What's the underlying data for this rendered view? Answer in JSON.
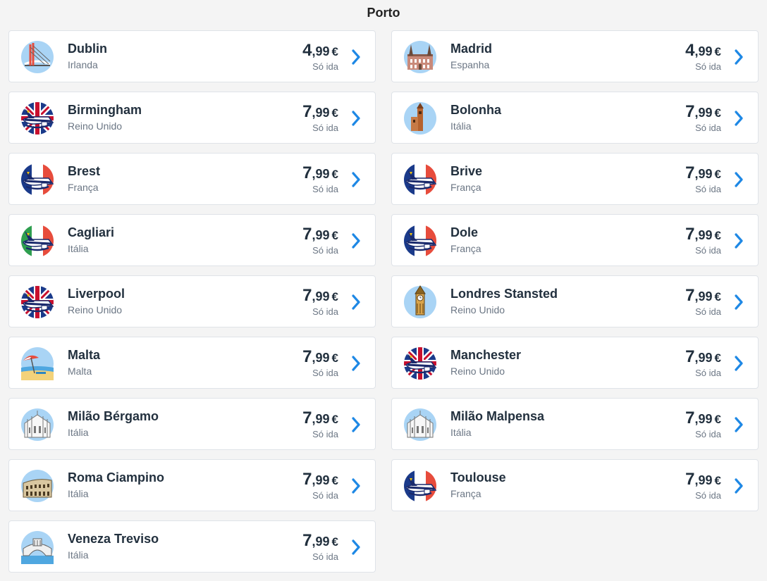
{
  "page": {
    "title": "Porto"
  },
  "colors": {
    "accent": "#1e88e5",
    "card_border": "#dfe3e8",
    "text": "#22303e",
    "muted": "#6b7684"
  },
  "destinations": [
    {
      "city": "Dublin",
      "country": "Irlanda",
      "price_int": "4",
      "price_dec": ",99",
      "currency": "€",
      "trip": "Só ida",
      "icon": "bridge-icon"
    },
    {
      "city": "Madrid",
      "country": "Espanha",
      "price_int": "4",
      "price_dec": ",99",
      "currency": "€",
      "trip": "Só ida",
      "icon": "palace-icon"
    },
    {
      "city": "Birmingham",
      "country": "Reino Unido",
      "price_int": "7",
      "price_dec": ",99",
      "currency": "€",
      "trip": "Só ida",
      "icon": "plane-uk-icon"
    },
    {
      "city": "Bolonha",
      "country": "Itália",
      "price_int": "7",
      "price_dec": ",99",
      "currency": "€",
      "trip": "Só ida",
      "icon": "tower-icon"
    },
    {
      "city": "Brest",
      "country": "França",
      "price_int": "7",
      "price_dec": ",99",
      "currency": "€",
      "trip": "Só ida",
      "icon": "plane-fr-icon"
    },
    {
      "city": "Brive",
      "country": "França",
      "price_int": "7",
      "price_dec": ",99",
      "currency": "€",
      "trip": "Só ida",
      "icon": "plane-fr-icon"
    },
    {
      "city": "Cagliari",
      "country": "Itália",
      "price_int": "7",
      "price_dec": ",99",
      "currency": "€",
      "trip": "Só ida",
      "icon": "plane-it-icon"
    },
    {
      "city": "Dole",
      "country": "França",
      "price_int": "7",
      "price_dec": ",99",
      "currency": "€",
      "trip": "Só ida",
      "icon": "plane-fr-icon"
    },
    {
      "city": "Liverpool",
      "country": "Reino Unido",
      "price_int": "7",
      "price_dec": ",99",
      "currency": "€",
      "trip": "Só ida",
      "icon": "plane-uk-icon"
    },
    {
      "city": "Londres Stansted",
      "country": "Reino Unido",
      "price_int": "7",
      "price_dec": ",99",
      "currency": "€",
      "trip": "Só ida",
      "icon": "big-ben-icon"
    },
    {
      "city": "Malta",
      "country": "Malta",
      "price_int": "7",
      "price_dec": ",99",
      "currency": "€",
      "trip": "Só ida",
      "icon": "beach-icon"
    },
    {
      "city": "Manchester",
      "country": "Reino Unido",
      "price_int": "7",
      "price_dec": ",99",
      "currency": "€",
      "trip": "Só ida",
      "icon": "plane-uk-icon"
    },
    {
      "city": "Milão Bérgamo",
      "country": "Itália",
      "price_int": "7",
      "price_dec": ",99",
      "currency": "€",
      "trip": "Só ida",
      "icon": "cathedral-icon"
    },
    {
      "city": "Milão Malpensa",
      "country": "Itália",
      "price_int": "7",
      "price_dec": ",99",
      "currency": "€",
      "trip": "Só ida",
      "icon": "cathedral-icon"
    },
    {
      "city": "Roma Ciampino",
      "country": "Itália",
      "price_int": "7",
      "price_dec": ",99",
      "currency": "€",
      "trip": "Só ida",
      "icon": "colosseum-icon"
    },
    {
      "city": "Toulouse",
      "country": "França",
      "price_int": "7",
      "price_dec": ",99",
      "currency": "€",
      "trip": "Só ida",
      "icon": "plane-fr-icon"
    },
    {
      "city": "Veneza Treviso",
      "country": "Itália",
      "price_int": "7",
      "price_dec": ",99",
      "currency": "€",
      "trip": "Só ida",
      "icon": "venice-bridge-icon"
    }
  ]
}
